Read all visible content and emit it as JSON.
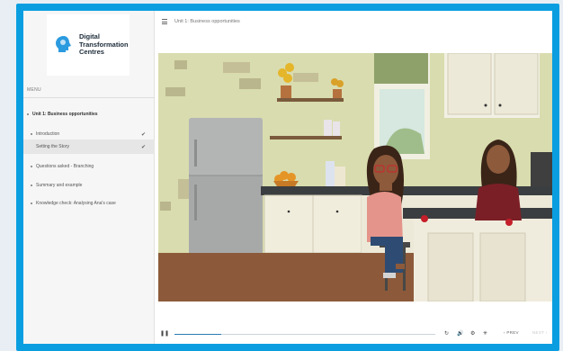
{
  "logo": {
    "line1": "Digital",
    "line2": "Transformation",
    "line3": "Centres"
  },
  "sidebar": {
    "menu_label": "MENU",
    "items": [
      {
        "label": "Unit 1: Business opportunities",
        "level": "top"
      },
      {
        "label": "Introduction",
        "checked": true
      },
      {
        "label": "Setting the Story",
        "checked": true,
        "active": true
      },
      {
        "label": "Questions asked - Branching"
      },
      {
        "label": "Summary and example"
      },
      {
        "label": "Knowledge check: Analysing Ana's case"
      }
    ],
    "check_glyph": "✔"
  },
  "header": {
    "title": "Unit 1: Business opportunities",
    "menu_icon": "hamburger-icon"
  },
  "player": {
    "progress": 0.18,
    "play_icon": "pause-icon",
    "replay_icon": "replay-icon",
    "volume_icon": "volume-icon",
    "settings_icon": "settings-icon",
    "prev_label": "PREV",
    "next_label": "NEXT",
    "accent": "#2e7bb5"
  },
  "colors": {
    "frame": "#0a9ee0"
  }
}
